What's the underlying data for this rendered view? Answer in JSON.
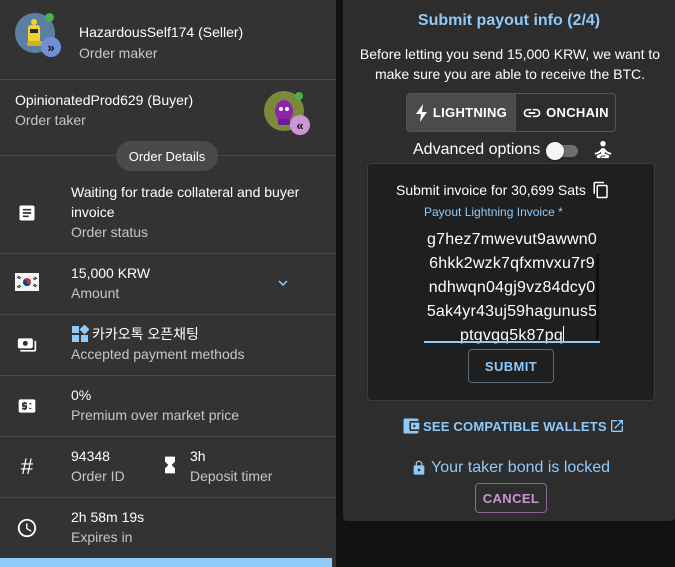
{
  "maker": {
    "name": "HazardousSelf174 (Seller)",
    "role": "Order maker",
    "badge": "»"
  },
  "taker": {
    "name": "OpinionatedProd629 (Buyer)",
    "role": "Order taker",
    "badge": "«"
  },
  "order_details_label": "Order Details",
  "order_status": {
    "value": "Waiting for trade collateral and buyer invoice",
    "label": "Order status"
  },
  "amount": {
    "value": "15,000 KRW",
    "label": "Amount"
  },
  "payment": {
    "value": "카카오톡 오픈채팅",
    "label": "Accepted payment methods"
  },
  "premium": {
    "value": "0%",
    "label": "Premium over market price"
  },
  "order_id": {
    "value": "94348",
    "label": "Order ID"
  },
  "deposit_timer": {
    "value": "3h",
    "label": "Deposit timer"
  },
  "expires": {
    "value": "2h 58m 19s",
    "label": "Expires in"
  },
  "payout": {
    "title": "Submit payout info (2/4)",
    "intro": "Before letting you send 15,000 KRW, we want to make sure you are able to receive the BTC.",
    "lightning_label": "LIGHTNING",
    "onchain_label": "ONCHAIN",
    "advanced_label": "Advanced options",
    "invoice_header": "Submit invoice for 30,699 Sats",
    "invoice_field_label": "Payout Lightning Invoice *",
    "invoice_lines": [
      "g7hez7mwevut9awwn0",
      "6hkk2wzk7qfxmvxu7r9",
      "ndhwqn04gj9vz84dcy0",
      "5ak4yr43uj59hagunus5",
      "ptgvgq5k87pq"
    ],
    "submit_label": "SUBMIT",
    "wallets_label": "SEE COMPATIBLE WALLETS",
    "bond_label": "Your taker bond is locked",
    "cancel_label": "CANCEL"
  },
  "colors": {
    "accent": "#90caf9",
    "secondary": "#ce93d8",
    "panel": "#333333"
  }
}
